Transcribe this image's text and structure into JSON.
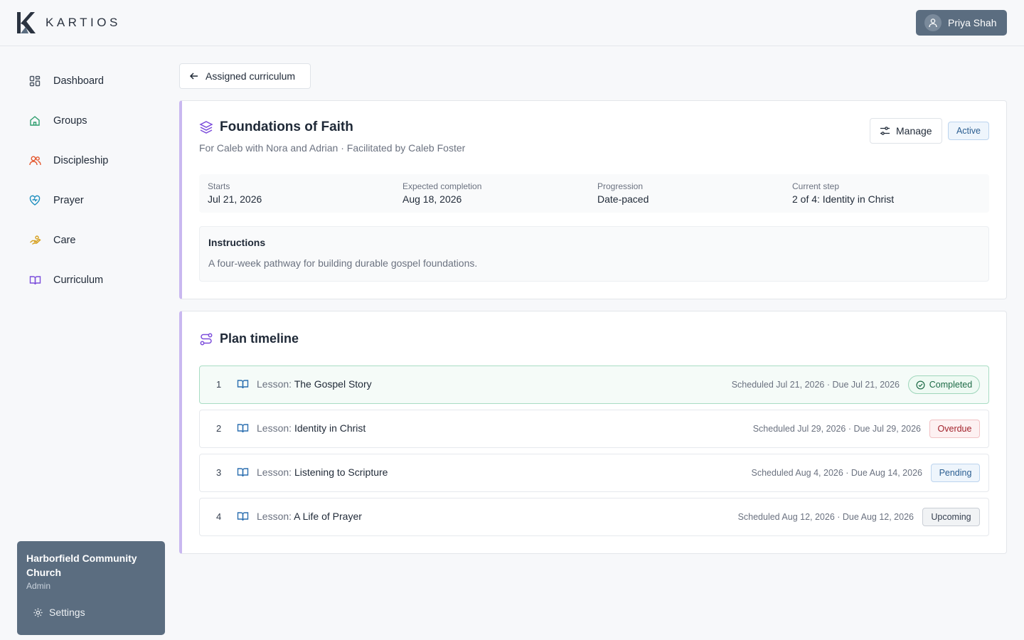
{
  "brand": {
    "name": "KARTIOS"
  },
  "user": {
    "name": "Priya Shah"
  },
  "nav": [
    {
      "label": "Dashboard",
      "icon": "grid-icon",
      "color": "#4b5563"
    },
    {
      "label": "Groups",
      "icon": "home-icon",
      "color": "#2f9e6e"
    },
    {
      "label": "Discipleship",
      "icon": "users-icon",
      "color": "#e4572e"
    },
    {
      "label": "Prayer",
      "icon": "heart-icon",
      "color": "#1f8fbf"
    },
    {
      "label": "Care",
      "icon": "hand-icon",
      "color": "#d6a01e"
    },
    {
      "label": "Curriculum",
      "icon": "book-icon",
      "color": "#7c4ddb"
    }
  ],
  "org": {
    "name": "Harborfield Community Church",
    "role": "Admin",
    "settings_label": "Settings"
  },
  "back": {
    "label": "Assigned curriculum"
  },
  "plan": {
    "title": "Foundations of Faith",
    "subtitle": "For Caleb with Nora and Adrian · Facilitated by Caleb Foster",
    "manage_label": "Manage",
    "status": "Active",
    "meta": [
      {
        "label": "Starts",
        "value": "Jul 21, 2026"
      },
      {
        "label": "Expected completion",
        "value": "Aug 18, 2026"
      },
      {
        "label": "Progression",
        "value": "Date-paced"
      },
      {
        "label": "Current step",
        "value": "2 of 4: Identity in Christ"
      }
    ],
    "instructions_title": "Instructions",
    "instructions_body": "A four-week pathway for building durable gospel foundations."
  },
  "timeline": {
    "title": "Plan timeline",
    "items": [
      {
        "num": "1",
        "prefix": "Lesson:",
        "name": "The Gospel Story",
        "schedule": "Scheduled Jul 21, 2026 · Due Jul 21, 2026",
        "status": "Completed"
      },
      {
        "num": "2",
        "prefix": "Lesson:",
        "name": "Identity in Christ",
        "schedule": "Scheduled Jul 29, 2026 · Due Jul 29, 2026",
        "status": "Overdue"
      },
      {
        "num": "3",
        "prefix": "Lesson:",
        "name": "Listening to Scripture",
        "schedule": "Scheduled Aug 4, 2026 · Due Aug 14, 2026",
        "status": "Pending"
      },
      {
        "num": "4",
        "prefix": "Lesson:",
        "name": "A Life of Prayer",
        "schedule": "Scheduled Aug 12, 2026 · Due Aug 12, 2026",
        "status": "Upcoming"
      }
    ]
  }
}
